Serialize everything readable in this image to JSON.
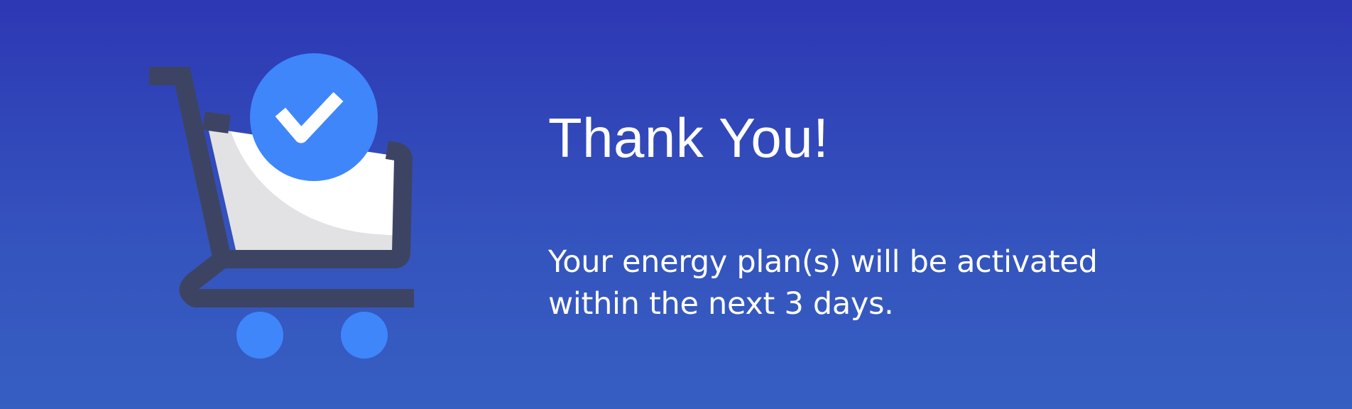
{
  "banner": {
    "title": "Thank You!",
    "message": "Your energy plan(s) will be activated within the next 3 days.",
    "icons": {
      "cart": "shopping-cart-icon",
      "check": "checkmark-circle-icon"
    },
    "colors": {
      "background_top": "#2d38b4",
      "background_bottom": "#365fc2",
      "cart_frame": "#3d4463",
      "cart_basket": "#e2e2e4",
      "accent_blue": "#3f86fb",
      "text": "#ffffff"
    }
  }
}
